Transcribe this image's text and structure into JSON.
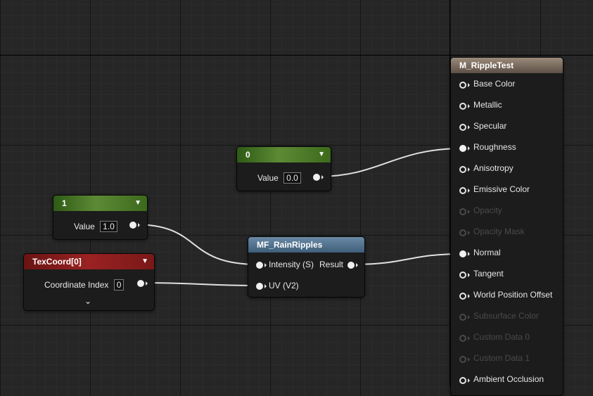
{
  "material_node": {
    "title": "M_RippleTest",
    "inputs": [
      {
        "label": "Base Color",
        "enabled": true,
        "connected": false
      },
      {
        "label": "Metallic",
        "enabled": true,
        "connected": false
      },
      {
        "label": "Specular",
        "enabled": true,
        "connected": false
      },
      {
        "label": "Roughness",
        "enabled": true,
        "connected": true
      },
      {
        "label": "Anisotropy",
        "enabled": true,
        "connected": false
      },
      {
        "label": "Emissive Color",
        "enabled": true,
        "connected": false
      },
      {
        "label": "Opacity",
        "enabled": false,
        "connected": false
      },
      {
        "label": "Opacity Mask",
        "enabled": false,
        "connected": false
      },
      {
        "label": "Normal",
        "enabled": true,
        "connected": true
      },
      {
        "label": "Tangent",
        "enabled": true,
        "connected": false
      },
      {
        "label": "World Position Offset",
        "enabled": true,
        "connected": false
      },
      {
        "label": "Subsurface Color",
        "enabled": false,
        "connected": false
      },
      {
        "label": "Custom Data 0",
        "enabled": false,
        "connected": false
      },
      {
        "label": "Custom Data 1",
        "enabled": false,
        "connected": false
      },
      {
        "label": "Ambient Occlusion",
        "enabled": true,
        "connected": false
      }
    ]
  },
  "constant_zero": {
    "title": "0",
    "value_label": "Value",
    "value": "0.0"
  },
  "constant_one": {
    "title": "1",
    "value_label": "Value",
    "value": "1.0"
  },
  "texcoord": {
    "title": "TexCoord[0]",
    "index_label": "Coordinate Index",
    "index": "0"
  },
  "rain_ripples": {
    "title": "MF_RainRipples",
    "input_intensity": "Intensity (S)",
    "input_uv": "UV (V2)",
    "output_result": "Result"
  },
  "colors": {
    "background": "#262626",
    "constant_header": "#4a7a2a",
    "texcoord_header": "#8a1d1d",
    "function_header": "#4a6f8c",
    "material_header": "#7a6a5a",
    "wire": "#e0e0e0"
  }
}
